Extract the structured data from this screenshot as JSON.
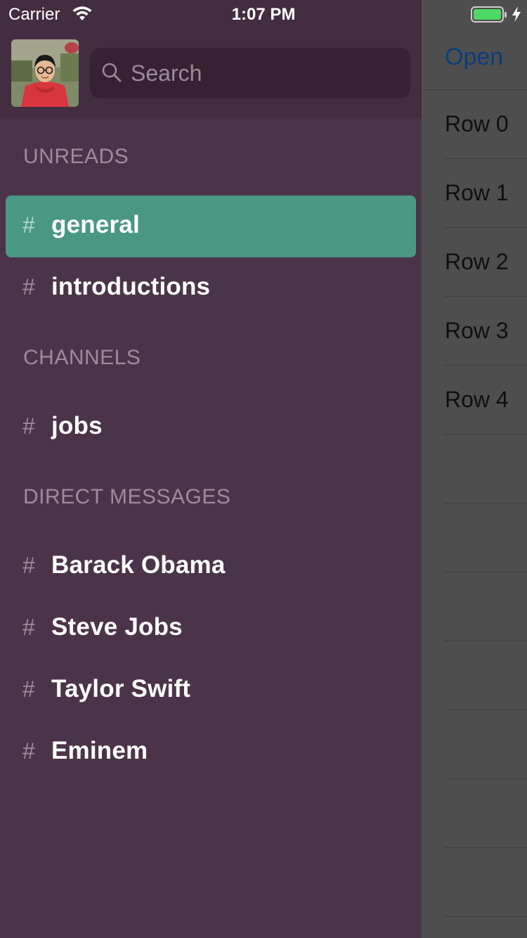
{
  "status_bar": {
    "carrier": "Carrier",
    "time": "1:07 PM"
  },
  "header": {
    "search_placeholder": "Search"
  },
  "content": {
    "open_label": "Open",
    "rows": [
      "Row 0",
      "Row 1",
      "Row 2",
      "Row 3",
      "Row 4",
      "",
      "",
      "",
      "",
      "",
      "",
      ""
    ]
  },
  "sections": {
    "unreads": "UNREADS",
    "channels": "CHANNELS",
    "direct_messages": "DIRECT MESSAGES"
  },
  "items": {
    "general": "general",
    "introductions": "introductions",
    "jobs": "jobs",
    "barack": "Barack Obama",
    "steve": "Steve Jobs",
    "taylor": "Taylor Swift",
    "eminem": "Eminem"
  },
  "hash_symbol": "#",
  "colors": {
    "drawer_bg": "#4b3449",
    "header_bg": "#432d40",
    "active_item": "#4a9786",
    "accent_link": "#0b3d78",
    "battery": "#4cd964"
  }
}
